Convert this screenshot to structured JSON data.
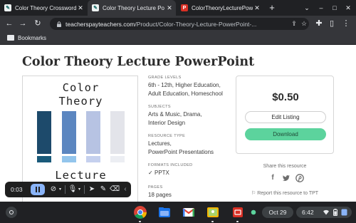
{
  "browser": {
    "tabs": [
      {
        "title": "Color Theory Crossword",
        "active": false,
        "favicon": "tpt-favicon"
      },
      {
        "title": "Color Theory Lecture Po",
        "active": true,
        "favicon": "tpt-favicon"
      },
      {
        "title": "ColorTheoryLecturePowe",
        "active": false,
        "favicon": "powerpoint-favicon"
      }
    ],
    "url_host": "teacherspayteachers.com",
    "url_path": "/Product/Color-Theory-Lecture-PowerPoint-...",
    "bookmarks_label": "Bookmarks"
  },
  "product": {
    "title": "Color Theory Lecture PowerPoint",
    "thumbnail": {
      "line1": "Color",
      "line2": "Theory",
      "line3": "Lecture",
      "swatch_colors": [
        "#1d4a6b",
        "#5b86c0",
        "#b7c3e3",
        "#e3e4ea"
      ],
      "swatch_bottom_colors": [
        "#1a5a7a",
        "#93c5ec",
        "#c5d0ee",
        "#eceef3"
      ]
    },
    "details": [
      {
        "heading": "GRADE LEVELS",
        "lines": [
          "6th - 12th, Higher Education,",
          "Adult Education, Homeschool"
        ]
      },
      {
        "heading": "SUBJECTS",
        "lines": [
          "Arts & Music, Drama,",
          "Interior Design"
        ]
      },
      {
        "heading": "RESOURCE TYPE",
        "lines": [
          "Lectures,",
          "PowerPoint Presentations"
        ]
      },
      {
        "heading": "FORMATS INCLUDED",
        "lines": [
          "PPTX"
        ]
      },
      {
        "heading": "PAGES",
        "lines": [
          "18 pages"
        ]
      }
    ],
    "price": "$0.50",
    "edit_label": "Edit Listing",
    "download_label": "Download",
    "share_heading": "Share this resource",
    "report_label": "Report this resource to TPT"
  },
  "recorder": {
    "time": "0:03"
  },
  "shelf": {
    "date": "Oct 29",
    "time": "6:42",
    "accent_green": "#5cd39d"
  }
}
